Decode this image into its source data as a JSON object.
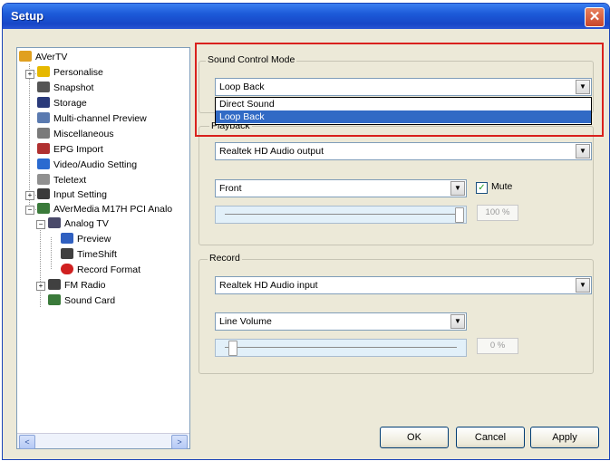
{
  "window": {
    "title": "Setup",
    "close_glyph": "✕"
  },
  "tree": {
    "items": [
      {
        "label": "AVerTV",
        "icon": "aver-icon",
        "color": "#e0a020"
      },
      {
        "label": "Personalise",
        "icon": "personalise-icon",
        "color": "#e6b800"
      },
      {
        "label": "Snapshot",
        "icon": "camera-icon",
        "color": "#555555"
      },
      {
        "label": "Storage",
        "icon": "disk-icon",
        "color": "#2a3a7a"
      },
      {
        "label": "Multi-channel Preview",
        "icon": "eye-icon",
        "color": "#5a7ab0"
      },
      {
        "label": "Miscellaneous",
        "icon": "wrench-icon",
        "color": "#7a7a7a"
      },
      {
        "label": "EPG Import",
        "icon": "epg-icon",
        "color": "#b03030"
      },
      {
        "label": "Video/Audio Setting",
        "icon": "tools-icon",
        "color": "#2a6ad0"
      },
      {
        "label": "Teletext",
        "icon": "teletext-icon",
        "color": "#909090"
      },
      {
        "label": "Input Setting",
        "icon": "input-icon",
        "color": "#3a3a3a"
      },
      {
        "label": "AVerMedia M17H PCI Analo",
        "icon": "device-icon",
        "color": "#3a7a3a"
      },
      {
        "label": "Analog TV",
        "icon": "tv-icon",
        "color": "#4a4a6a"
      },
      {
        "label": "Preview",
        "icon": "preview-icon",
        "color": "#3060c0"
      },
      {
        "label": "TimeShift",
        "icon": "timeshift-icon",
        "color": "#404040"
      },
      {
        "label": "Record Format",
        "icon": "record-icon",
        "color": "#d02020"
      },
      {
        "label": "FM Radio",
        "icon": "radio-icon",
        "color": "#404040"
      },
      {
        "label": "Sound Card",
        "icon": "soundcard-icon",
        "color": "#3a7a3a"
      }
    ],
    "expanders": {
      "plus": "+",
      "minus": "−"
    },
    "scroll_left": "<",
    "scroll_right": ">"
  },
  "sound_control": {
    "label": "Sound Control Mode",
    "value": "Loop Back",
    "options": [
      "Direct Sound",
      "Loop Back"
    ]
  },
  "playback": {
    "label": "Playback",
    "device": "Realtek HD Audio output",
    "channel": "Front",
    "mute_label": "Mute",
    "mute_checked": true,
    "check_glyph": "✓",
    "volume_text": "100 %",
    "volume_level": 1.0
  },
  "record": {
    "label": "Record",
    "device": "Realtek HD Audio input",
    "channel": "Line Volume",
    "volume_text": "0 %",
    "volume_level": 0.0
  },
  "dropdown_arrow": "▼",
  "buttons": {
    "ok": "OK",
    "cancel": "Cancel",
    "apply": "Apply"
  },
  "colors": {
    "highlight": "#d9211d",
    "selection": "#316ac5",
    "titlebar": "#1c5ad9"
  }
}
